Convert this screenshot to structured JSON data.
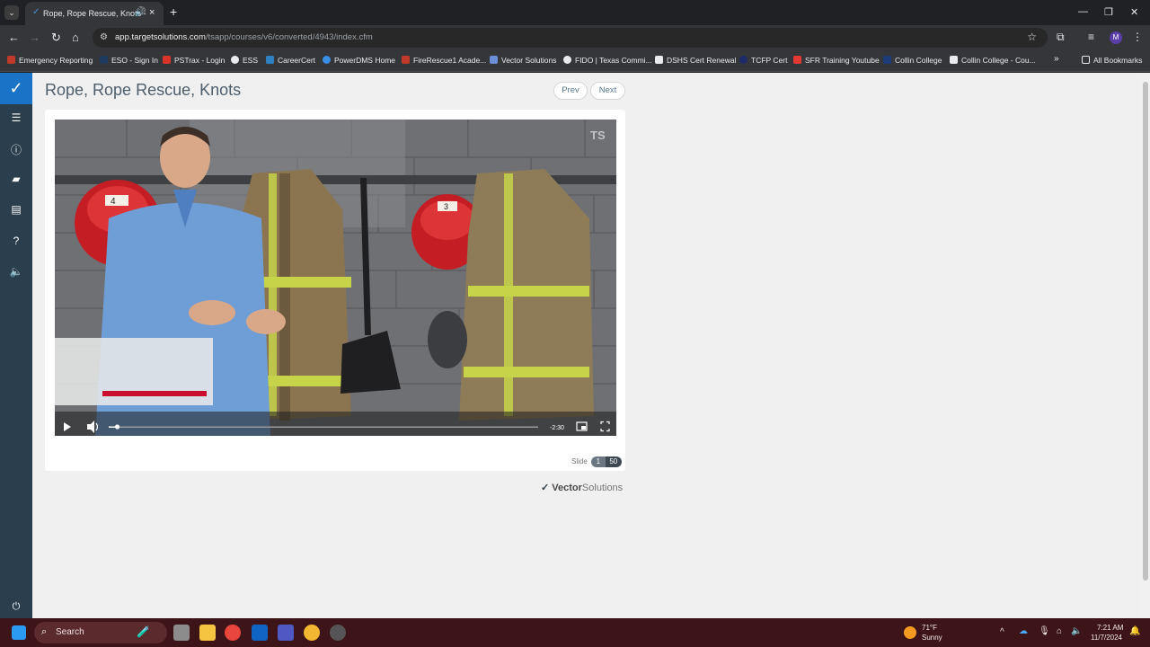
{
  "browser": {
    "tab_title": "Rope, Rope Rescue, Knots -",
    "url_host": "app.targetsolutions.com",
    "url_path": "/tsapp/courses/v6/converted/4943/index.cfm",
    "profile_initial": "M"
  },
  "bookmarks": [
    {
      "label": "Emergency Reporting",
      "color": "#c0392b"
    },
    {
      "label": "ESO - Sign In",
      "color": "#1f3a5f"
    },
    {
      "label": "PSTrax - Login",
      "color": "#d9342b"
    },
    {
      "label": "ESS",
      "color": "#e8eaed"
    },
    {
      "label": "CareerCert",
      "color": "#2f80c2"
    },
    {
      "label": "PowerDMS Home",
      "color": "#3a8ee6"
    },
    {
      "label": "FireRescue1 Acade...",
      "color": "#c0392b"
    },
    {
      "label": "Vector Solutions",
      "color": "#6a8fd6"
    },
    {
      "label": "FIDO | Texas Commi...",
      "color": "#e8eaed"
    },
    {
      "label": "DSHS Cert Renewal",
      "color": "#e8eaed"
    },
    {
      "label": "TCFP Cert",
      "color": "#1f2a6b"
    },
    {
      "label": "SFR Training Youtube",
      "color": "#e53935"
    },
    {
      "label": "Collin College",
      "color": "#1d3c7a"
    },
    {
      "label": "Collin College - Cou...",
      "color": "#e8eaed"
    }
  ],
  "all_bookmarks_label": "All Bookmarks",
  "course": {
    "title": "Rope, Rope Rescue, Knots",
    "prev_label": "Prev",
    "next_label": "Next",
    "slide_label": "Slide",
    "slide_current": "1",
    "slide_total": "50",
    "vendor_logo_bold": "Vector",
    "vendor_logo_rest": "Solutions"
  },
  "video": {
    "time_remaining": "-2:30",
    "progress_fraction": 0.02,
    "watermark": "TS"
  },
  "taskbar": {
    "search_label": "Search",
    "weather_temp": "71°F",
    "weather_desc": "Sunny",
    "time": "7:21 AM",
    "date": "11/7/2024"
  },
  "colors": {
    "nav_bg": "#2a3e4d",
    "nav_accent": "#1a73c7",
    "taskbar_bg": "#3d1518",
    "caption_bar": "#c8102e"
  }
}
